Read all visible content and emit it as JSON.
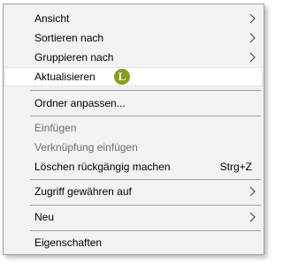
{
  "menu": {
    "items": [
      {
        "label": "Ansicht"
      },
      {
        "label": "Sortieren nach"
      },
      {
        "label": "Gruppieren nach"
      },
      {
        "label": "Aktualisieren",
        "badge": "L"
      },
      {
        "label": "Ordner anpassen..."
      },
      {
        "label": "Einfügen"
      },
      {
        "label": "Verknüpfung einfügen"
      },
      {
        "label": "Löschen rückgängig machen",
        "shortcut": "Strg+Z"
      },
      {
        "label": "Zugriff gewähren auf"
      },
      {
        "label": "Neu"
      },
      {
        "label": "Eigenschaften"
      }
    ]
  },
  "colors": {
    "menu_background": "#f2f2f2",
    "hover_background": "#ffffff",
    "badge": "#8a9b1c",
    "disabled_text": "#6d6d6d",
    "separator": "#a0a0a0"
  },
  "icons": {
    "submenu": "chevron-right-icon"
  }
}
